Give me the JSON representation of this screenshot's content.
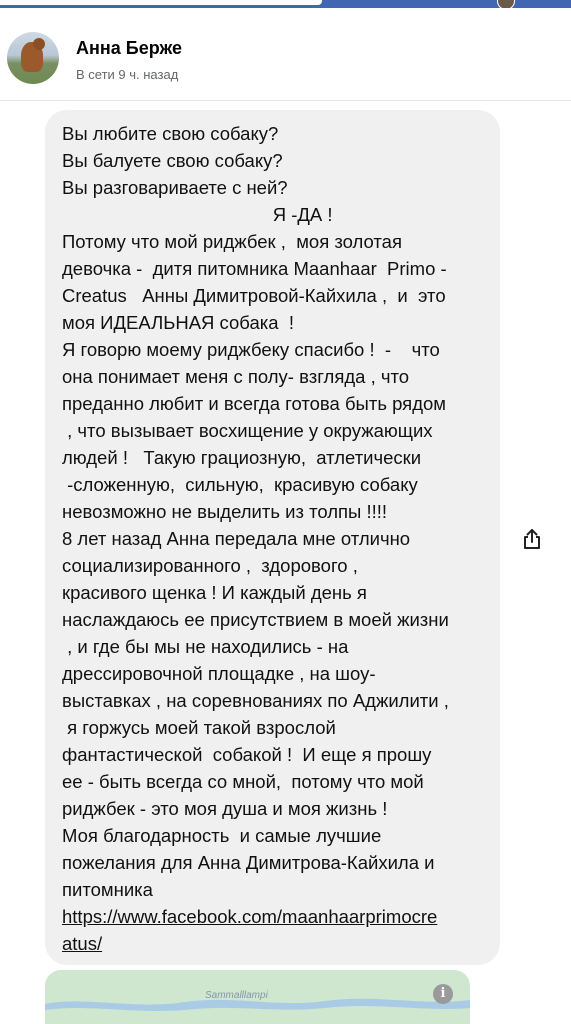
{
  "contact": {
    "name": "Анна Берже",
    "status": "В сети 9 ч. назад"
  },
  "message": {
    "lines": [
      "Вы любите свою собаку?",
      "Вы балуете свою собаку?",
      "Вы разговариваете с ней?",
      "                                         Я -ДА !",
      "Потому что мой риджбек ,  моя золотая",
      "девочка -  дитя питомника Maanhaar  Primo -",
      "Creatus   Анны Димитровой-Кайхила ,  и  это",
      "моя ИДЕАЛЬНАЯ собака  !",
      "Я говорю моему риджбеку спасибо !  -    что",
      "она понимает меня с полу- взгляда , что",
      "преданно любит и всегда готова быть рядом",
      " , что вызывает восхищение у окружающих",
      "людей !   Такую грациозную,  атлетически",
      " -сложенную,  сильную,  красивую собаку",
      "невозможно не выделить из толпы !!!!",
      "8 лет назад Анна передала мне отлично",
      "социализированного ,  здорового ,",
      "красивого щенка ! И каждый день я",
      "наслаждаюсь ее присутствием в моей жизни",
      " , и где бы мы не находились - на",
      "дрессировочной площадке , на шоу-",
      "выставках , на соревнованиях по Аджилити ,",
      " я горжусь моей такой взрослой",
      "фантастической  собакой !  И еще я прошу",
      "ее - быть всегда со мной,  потому что мой",
      "риджбек - это моя душа и моя жизнь !",
      "Моя благодарность  и самые лучшие",
      "пожелания для Анна Димитрова-Кайхила и",
      "питомника"
    ],
    "link_lines": [
      "https://www.facebook.com/maanhaarprimocre",
      "atus/"
    ]
  },
  "map": {
    "place_label": "Sammalllampi",
    "info_icon": "info-icon",
    "land_color": "#cfe6cf",
    "water_color": "#aacbe6"
  },
  "icons": {
    "share": "share-icon"
  },
  "colors": {
    "top_bar": "#4267b2",
    "bubble": "#f0f0f0"
  }
}
